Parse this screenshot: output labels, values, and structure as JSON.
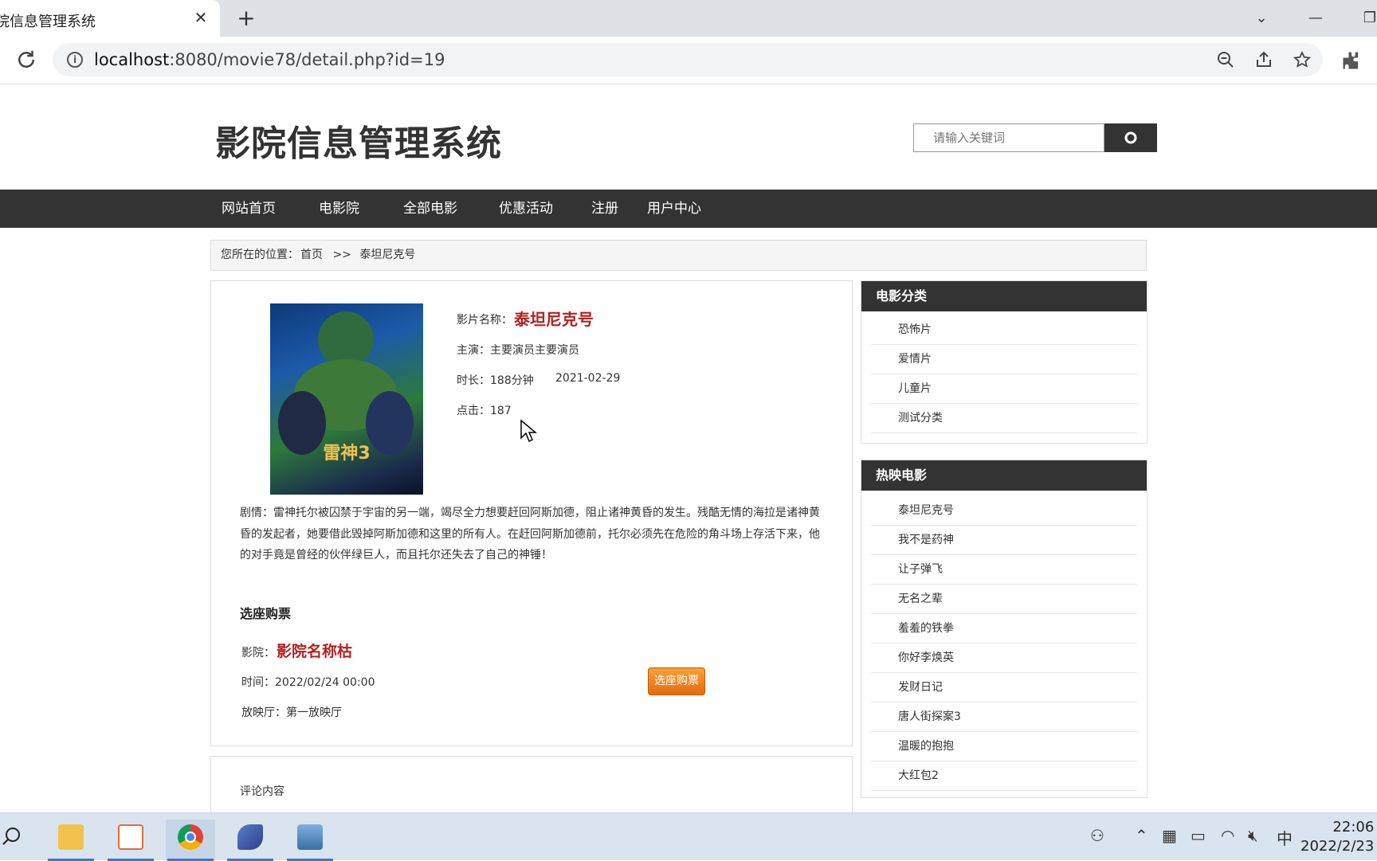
{
  "browser": {
    "tab_title": "院信息管理系统",
    "url_host": "localhost",
    "url_rest": ":8080/movie78/detail.php?id=19"
  },
  "site": {
    "title": "影院信息管理系统",
    "search_placeholder": "请输入关键词"
  },
  "nav": {
    "items": [
      "网站首页",
      "电影院",
      "全部电影",
      "优惠活动",
      "注册",
      "用户中心"
    ]
  },
  "breadcrumb": {
    "prefix": "您所在的位置：",
    "home": "首页",
    "sep": ">>",
    "current": "泰坦尼克号"
  },
  "movie": {
    "poster_text": "雷神3",
    "name_label": "影片名称：",
    "name": "泰坦尼克号",
    "actors": "主演：主要演员主要演员",
    "duration": "时长：188分钟",
    "date": "2021-02-29",
    "clicks": "点击：187",
    "plot": "剧情：雷神托尔被囚禁于宇宙的另一端，竭尽全力想要赶回阿斯加德，阻止诸神黄昏的发生。残酷无情的海拉是诸神黄昏的发起者，她要借此毁掉阿斯加德和这里的所有人。在赶回阿斯加德前，托尔必须先在危险的角斗场上存活下来，他的对手竟是曾经的伙伴绿巨人，而且托尔还失去了自己的神锤！"
  },
  "ticket": {
    "section_title": "选座购票",
    "cinema_label": "影院：",
    "cinema_name": "影院名称枯",
    "time": "时间：2022/02/24 00:00",
    "hall": "放映厅：第一放映厅",
    "buy_label": "选座购票"
  },
  "comments": {
    "label": "评论内容"
  },
  "sidebar": {
    "categories_title": "电影分类",
    "categories": [
      "恐怖片",
      "爱情片",
      "儿童片",
      "测试分类"
    ],
    "hot_title": "热映电影",
    "hot": [
      "泰坦尼克号",
      "我不是药神",
      "让子弹飞",
      "无名之辈",
      "羞羞的铁拳",
      "你好李焕英",
      "发财日记",
      "唐人街探案3",
      "温暖的抱抱",
      "大红包2"
    ]
  },
  "taskbar": {
    "time": "22:06",
    "date": "2022/2/23",
    "ime": "中"
  }
}
